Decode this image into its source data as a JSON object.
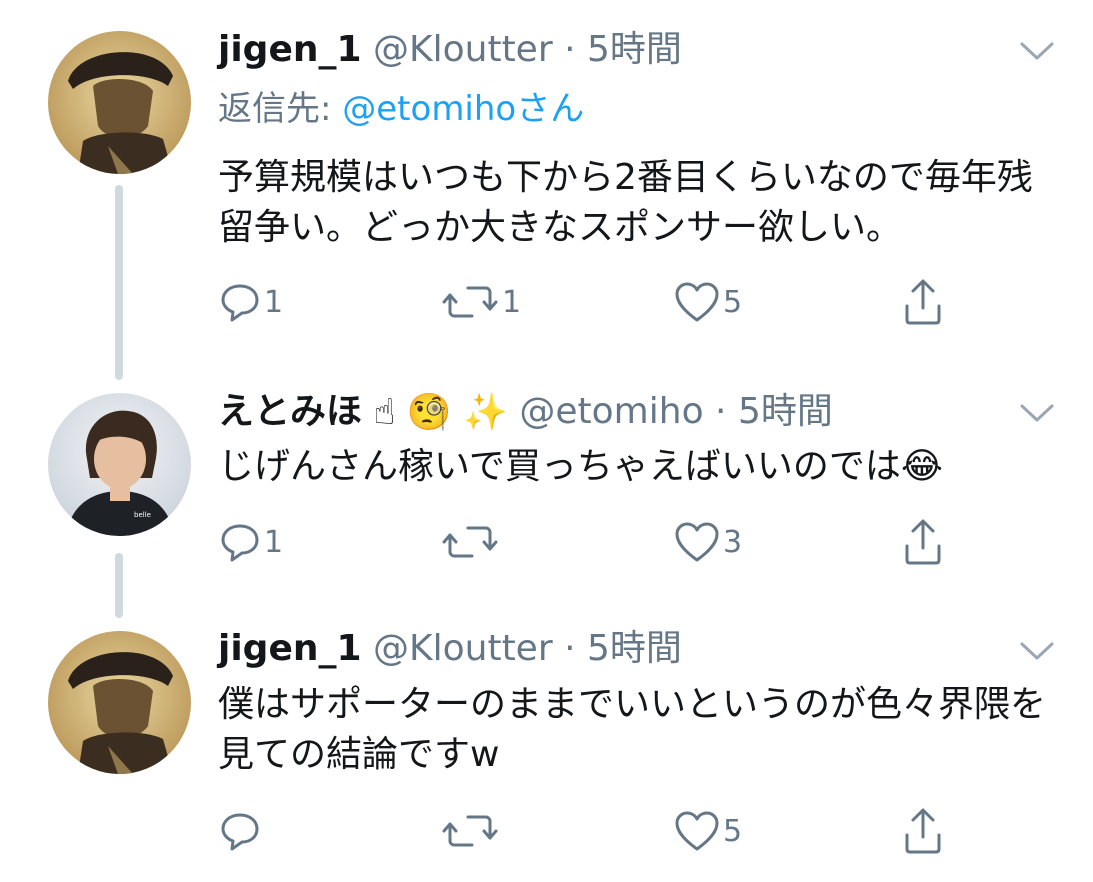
{
  "tweets": [
    {
      "name": "jigen_1",
      "handle": "@Kloutter",
      "dot": "·",
      "time": "5時間",
      "reply_prefix": "返信先: ",
      "reply_mention": "@etomiho",
      "reply_suffix": "さん",
      "text": "予算規模はいつも下から2番目くらいなので毎年残留争い。どっか大きなスポンサー欲しい。",
      "replies": "1",
      "retweets": "1",
      "likes": "5"
    },
    {
      "name": "えとみほ",
      "name_emoji": "☝ 🧐 ✨",
      "handle": "@etomiho",
      "dot": "·",
      "time": "5時間",
      "text": "じげんさん稼いで買っちゃえばいいのでは",
      "text_emoji": "😂",
      "replies": "1",
      "retweets": "",
      "likes": "3"
    },
    {
      "name": "jigen_1",
      "handle": "@Kloutter",
      "dot": "·",
      "time": "5時間",
      "text": "僕はサポーターのままでいいというのが色々界隈を見ての結論ですw",
      "replies": "",
      "retweets": "",
      "likes": "5"
    }
  ],
  "colors": {
    "text": "#14171a",
    "muted": "#657786",
    "link": "#1da1f2",
    "thread_line": "#cfd9de"
  },
  "icons": [
    "chevron-down-icon",
    "reply-icon",
    "retweet-icon",
    "like-icon",
    "share-icon"
  ]
}
